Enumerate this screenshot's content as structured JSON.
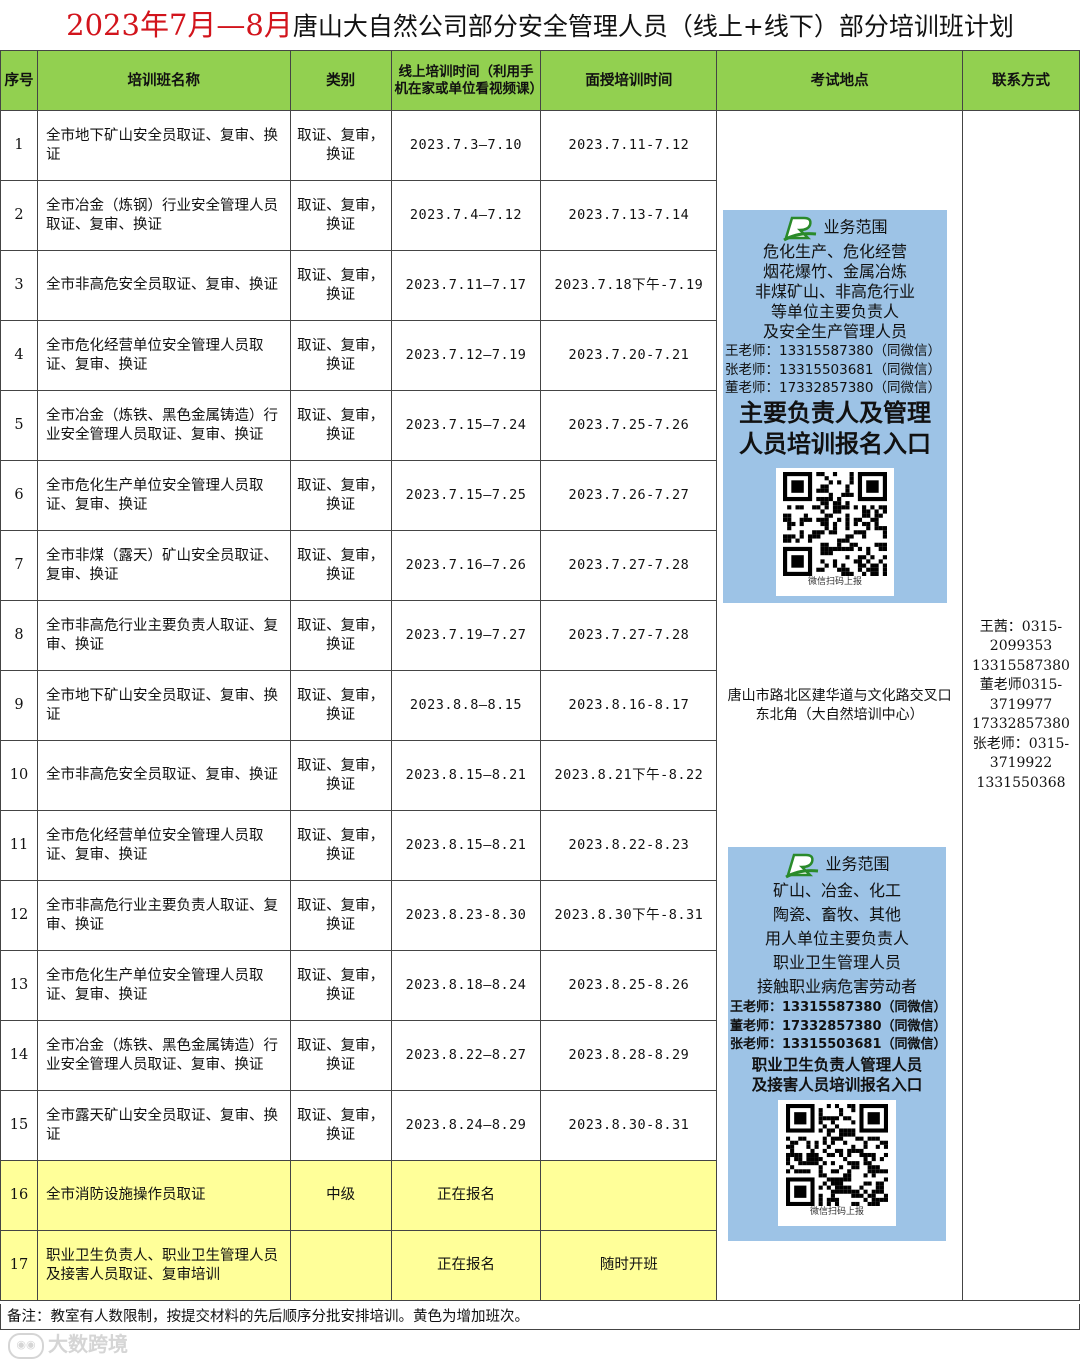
{
  "title": {
    "red_part": "2023年7月—8月",
    "black_part": "唐山大自然公司部分安全管理人员（线上+线下）部分培训班计划"
  },
  "table": {
    "headers": {
      "seq": "序号",
      "name": "培训班名称",
      "category": "类别",
      "online": "线上培训时间（利用手机在家或单位看视频课）",
      "offline": "面授培训时间",
      "location": "考试地点",
      "contact": "联系方式"
    },
    "rows": [
      {
        "seq": "1",
        "name": "全市地下矿山安全员取证、复审、换证",
        "category": "取证、复审，换证",
        "online": "2023.7.3—7.10",
        "offline": "2023.7.11-7.12"
      },
      {
        "seq": "2",
        "name": "全市冶金（炼钢）行业安全管理人员取证、复审、换证",
        "category": "取证、复审，换证",
        "online": "2023.7.4—7.12",
        "offline": "2023.7.13-7.14"
      },
      {
        "seq": "3",
        "name": "全市非高危安全员取证、复审、换证",
        "category": "取证、复审，换证",
        "online": "2023.7.11—7.17",
        "offline": "2023.7.18下午-7.19"
      },
      {
        "seq": "4",
        "name": "全市危化经营单位安全管理人员取证、复审、换证",
        "category": "取证、复审，换证",
        "online": "2023.7.12—7.19",
        "offline": "2023.7.20-7.21"
      },
      {
        "seq": "5",
        "name": "全市冶金（炼铁、黑色金属铸造）行业安全管理人员取证、复审、换证",
        "category": "取证、复审，换证",
        "online": "2023.7.15—7.24",
        "offline": "2023.7.25-7.26"
      },
      {
        "seq": "6",
        "name": "全市危化生产单位安全管理人员取证、复审、换证",
        "category": "取证、复审，换证",
        "online": "2023.7.15—7.25",
        "offline": "2023.7.26-7.27"
      },
      {
        "seq": "7",
        "name": "全市非煤（露天）矿山安全员取证、复审、换证",
        "category": "取证、复审，换证",
        "online": "2023.7.16—7.26",
        "offline": "2023.7.27-7.28"
      },
      {
        "seq": "8",
        "name": "全市非高危行业主要负责人取证、复审、换证",
        "category": "取证、复审，换证",
        "online": "2023.7.19—7.27",
        "offline": "2023.7.27-7.28"
      },
      {
        "seq": "9",
        "name": "全市地下矿山安全员取证、复审、换证",
        "category": "取证、复审，换证",
        "online": "2023.8.8—8.15",
        "offline": "2023.8.16-8.17"
      },
      {
        "seq": "10",
        "name": "全市非高危安全员取证、复审、换证",
        "category": "取证、复审，换证",
        "online": "2023.8.15—8.21",
        "offline": "2023.8.21下午-8.22"
      },
      {
        "seq": "11",
        "name": "全市危化经营单位安全管理人员取证、复审、换证",
        "category": "取证、复审，换证",
        "online": "2023.8.15—8.21",
        "offline": "2023.8.22-8.23"
      },
      {
        "seq": "12",
        "name": "全市非高危行业主要负责人取证、复审、换证",
        "category": "取证、复审，换证",
        "online": "2023.8.23-8.30",
        "offline": "2023.8.30下午-8.31"
      },
      {
        "seq": "13",
        "name": "全市危化生产单位安全管理人员取证、复审、换证",
        "category": "取证、复审，换证",
        "online": "2023.8.18—8.24",
        "offline": "2023.8.25-8.26"
      },
      {
        "seq": "14",
        "name": "全市冶金（炼铁、黑色金属铸造）行业安全管理人员取证、复审、换证",
        "category": "取证、复审，换证",
        "online": "2023.8.22—8.27",
        "offline": "2023.8.28-8.29"
      },
      {
        "seq": "15",
        "name": "全市露天矿山安全员取证、复审、换证",
        "category": "取证、复审，换证",
        "online": "2023.8.24—8.29",
        "offline": "2023.8.30-8.31"
      },
      {
        "seq": "16",
        "name": "全市消防设施操作员取证",
        "category": "中级",
        "online": "正在报名",
        "offline": ""
      },
      {
        "seq": "17",
        "name": "职业卫生负责人、职业卫生管理人员及接害人员取证、复审培训",
        "category": "",
        "online": "正在报名",
        "offline": "随时开班"
      }
    ],
    "location_text": "唐山市路北区建华道与文化路交叉口东北角（大自然培训中心）",
    "contact_lines": [
      "王茜：0315-",
      "2099353",
      "13315587380",
      "董老师0315-",
      "3719977",
      "17332857380",
      "张老师：0315-",
      "3719922",
      "1331550368"
    ]
  },
  "panel1": {
    "heading": "业务范围",
    "lines": [
      "危化生产、危化经营",
      "烟花爆竹、金属冶炼",
      "非煤矿山、非高危行业",
      "等单位主要负责人",
      "及安全生产管理人员"
    ],
    "contacts": [
      "王老师：13315587380（同微信）",
      "张老师：13315503681（同微信）",
      "董老师：17332857380（同微信）"
    ],
    "cta": [
      "主要负责人及管理",
      "人员培训报名入口"
    ],
    "qr_caption": "微信扫码上报"
  },
  "panel2": {
    "heading": "业务范围",
    "lines": [
      "矿山、冶金、化工",
      "陶瓷、畜牧、其他",
      "用人单位主要负责人",
      "职业卫生管理人员",
      "接触职业病危害劳动者"
    ],
    "contacts": [
      "王老师：13315587380（同微信）",
      "董老师：17332857380（同微信）",
      "张老师：13315503681（同微信）"
    ],
    "cta": [
      "职业卫生负责人管理人员",
      "及接害人员培训报名入口"
    ],
    "qr_caption": "微信扫码上报"
  },
  "footer": "备注：教室有人数限制，按提交材料的先后顺序分批安排培训。黄色为增加班次。",
  "watermark": "大数跨境",
  "colors": {
    "header_green": "#92d050",
    "added_yellow": "#ffff99",
    "panel_blue": "#9dc3e6",
    "title_red": "#d2141c"
  }
}
